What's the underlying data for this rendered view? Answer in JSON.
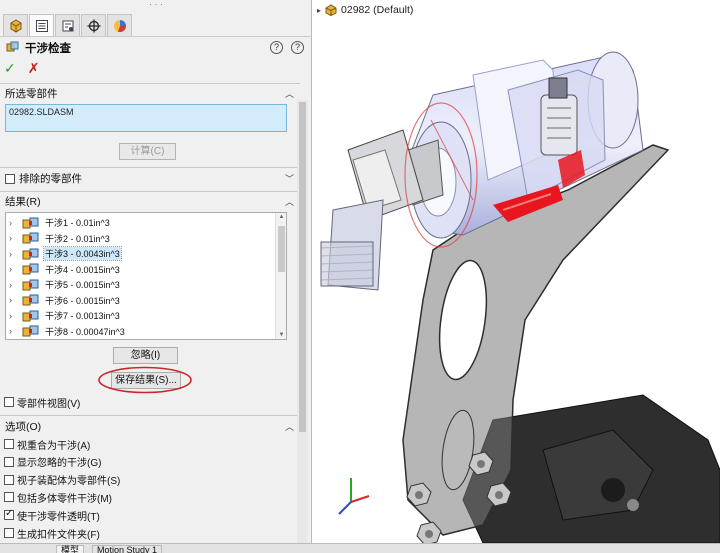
{
  "property_manager": {
    "tabs": [
      {
        "icon": "feature-manager-icon"
      },
      {
        "icon": "property-manager-icon"
      },
      {
        "icon": "configuration-manager-icon"
      },
      {
        "icon": "dimxpert-icon"
      },
      {
        "icon": "display-manager-icon"
      }
    ],
    "title": "干涉检查",
    "help_icon": "help-icon",
    "ok_icon": "check-icon",
    "cancel_icon": "close-icon",
    "selected_components": {
      "heading": "所选零部件",
      "value": "02982.SLDASM",
      "calculate_label": "计算(C)"
    },
    "excluded_components": {
      "heading": "排除的零部件",
      "checked": false
    },
    "results": {
      "heading": "结果(R)",
      "items": [
        {
          "label": "干涉1 - 0.01in^3",
          "selected": false
        },
        {
          "label": "干涉2 - 0.01in^3",
          "selected": false
        },
        {
          "label": "干涉3 - 0.0043in^3",
          "selected": true
        },
        {
          "label": "干涉4 - 0.0015in^3",
          "selected": false
        },
        {
          "label": "干涉5 - 0.0015in^3",
          "selected": false
        },
        {
          "label": "干涉6 - 0.0015in^3",
          "selected": false
        },
        {
          "label": "干涉7 - 0.0013in^3",
          "selected": false
        },
        {
          "label": "干涉8 - 0.00047in^3",
          "selected": false
        }
      ],
      "ignore_label": "忽略(I)",
      "save_results_label": "保存结果(S)...",
      "component_view_label": "零部件视图(V)",
      "component_view_checked": false
    },
    "options": {
      "heading": "选项(O)",
      "items": [
        {
          "label": "视重合为干涉(A)",
          "checked": false
        },
        {
          "label": "显示忽略的干涉(G)",
          "checked": false
        },
        {
          "label": "视子装配体为零部件(S)",
          "checked": false
        },
        {
          "label": "包括多体零件干涉(M)",
          "checked": false
        },
        {
          "label": "使干涉零件透明(T)",
          "checked": true
        },
        {
          "label": "生成扣件文件夹(F)",
          "checked": false
        }
      ]
    }
  },
  "viewport": {
    "tree_flyout": {
      "expand_arrow": "▸",
      "label": "02982  (Default)"
    }
  },
  "bottom_tabs": {
    "model_label": "模型",
    "motion_label": "Motion Study 1"
  },
  "colors": {
    "accent_blue": "#79b8dd",
    "selection_fill": "#d3ecfb",
    "interference_red": "#e8161e",
    "ok_green": "#2a9a2a",
    "cancel_red": "#c81818"
  }
}
